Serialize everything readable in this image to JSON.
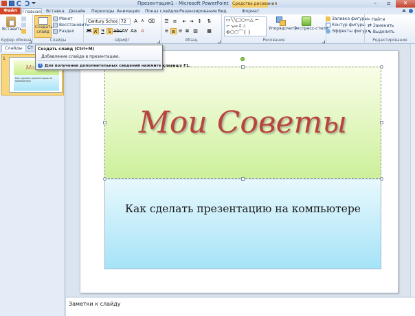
{
  "titlebar": {
    "title": "Презентация1 - Microsoft PowerPoint",
    "context_tools": "Средства рисования"
  },
  "tabs": [
    "Файл",
    "Главная",
    "Вставка",
    "Дизайн",
    "Переходы",
    "Анимация",
    "Показ слайдов",
    "Рецензирование",
    "Вид",
    "Формат"
  ],
  "ribbon": {
    "clipboard": {
      "label": "Буфер обмена",
      "paste": "Вставить"
    },
    "slides": {
      "label": "Слайды",
      "new_slide_1": "Создать",
      "new_slide_2": "слайд",
      "layout": "Макет",
      "reset": "Восстановить",
      "section": "Раздел"
    },
    "font": {
      "label": "Шрифт",
      "family": "Century Schoolb",
      "size": "72"
    },
    "paragraph": {
      "label": "Абзац"
    },
    "drawing": {
      "label": "Рисование",
      "arrange": "Упорядочить",
      "quick_styles": "Экспресс-стили",
      "fill": "Заливка фигуры",
      "outline": "Контур фигуры",
      "effects": "Эффекты фигур"
    },
    "editing": {
      "label": "Редактирование",
      "find": "Найти",
      "replace": "Заменить",
      "select": "Выделить"
    }
  },
  "panel": {
    "tab_slides": "Слайды",
    "tab_outline": "Ст",
    "slide_number": "1",
    "thumb_title": "Мои Сс",
    "thumb_subtitle": "Как сделать презентацию на компьютере"
  },
  "tooltip": {
    "title": "Создать слайд (Ctrl+M)",
    "description": "Добавление слайда в презентацию.",
    "help": "Для получения дополнительных сведений нажмите клавишу F1."
  },
  "slide": {
    "title": "Мои Советы",
    "subtitle": "Как сделать презентацию на компьютере"
  },
  "notes": {
    "placeholder": "Заметки к слайду"
  },
  "colors": {
    "file_tab": "#d24726",
    "title_text": "#b8443d",
    "title_fill_top": "#f9fde8",
    "title_fill_bottom": "#cdf09b",
    "subtitle_fill_top": "#e8f8fd",
    "subtitle_fill_bottom": "#a5e3f7",
    "selected_thumb": "#fbd57a"
  }
}
